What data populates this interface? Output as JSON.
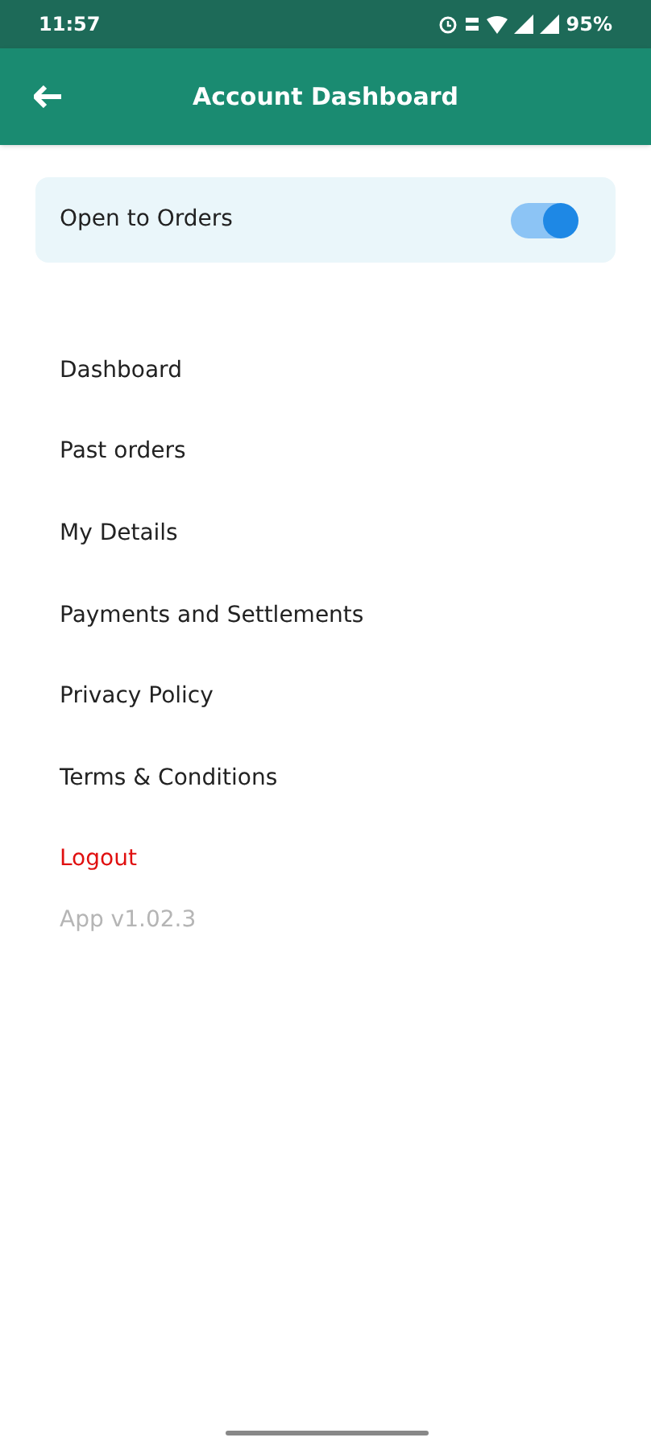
{
  "status_bar": {
    "time": "11:57",
    "battery": "95%"
  },
  "app_bar": {
    "title": "Account Dashboard"
  },
  "toggle_card": {
    "label": "Open to Orders",
    "on": true
  },
  "menu": [
    {
      "label": "Dashboard",
      "kind": "normal"
    },
    {
      "label": "Past orders",
      "kind": "normal"
    },
    {
      "label": "My Details",
      "kind": "normal"
    },
    {
      "label": "Payments and Settlements",
      "kind": "normal"
    },
    {
      "label": "Privacy Policy",
      "kind": "normal"
    },
    {
      "label": "Terms & Conditions",
      "kind": "normal"
    },
    {
      "label": "Logout",
      "kind": "danger"
    }
  ],
  "version": "App v1.02.3"
}
